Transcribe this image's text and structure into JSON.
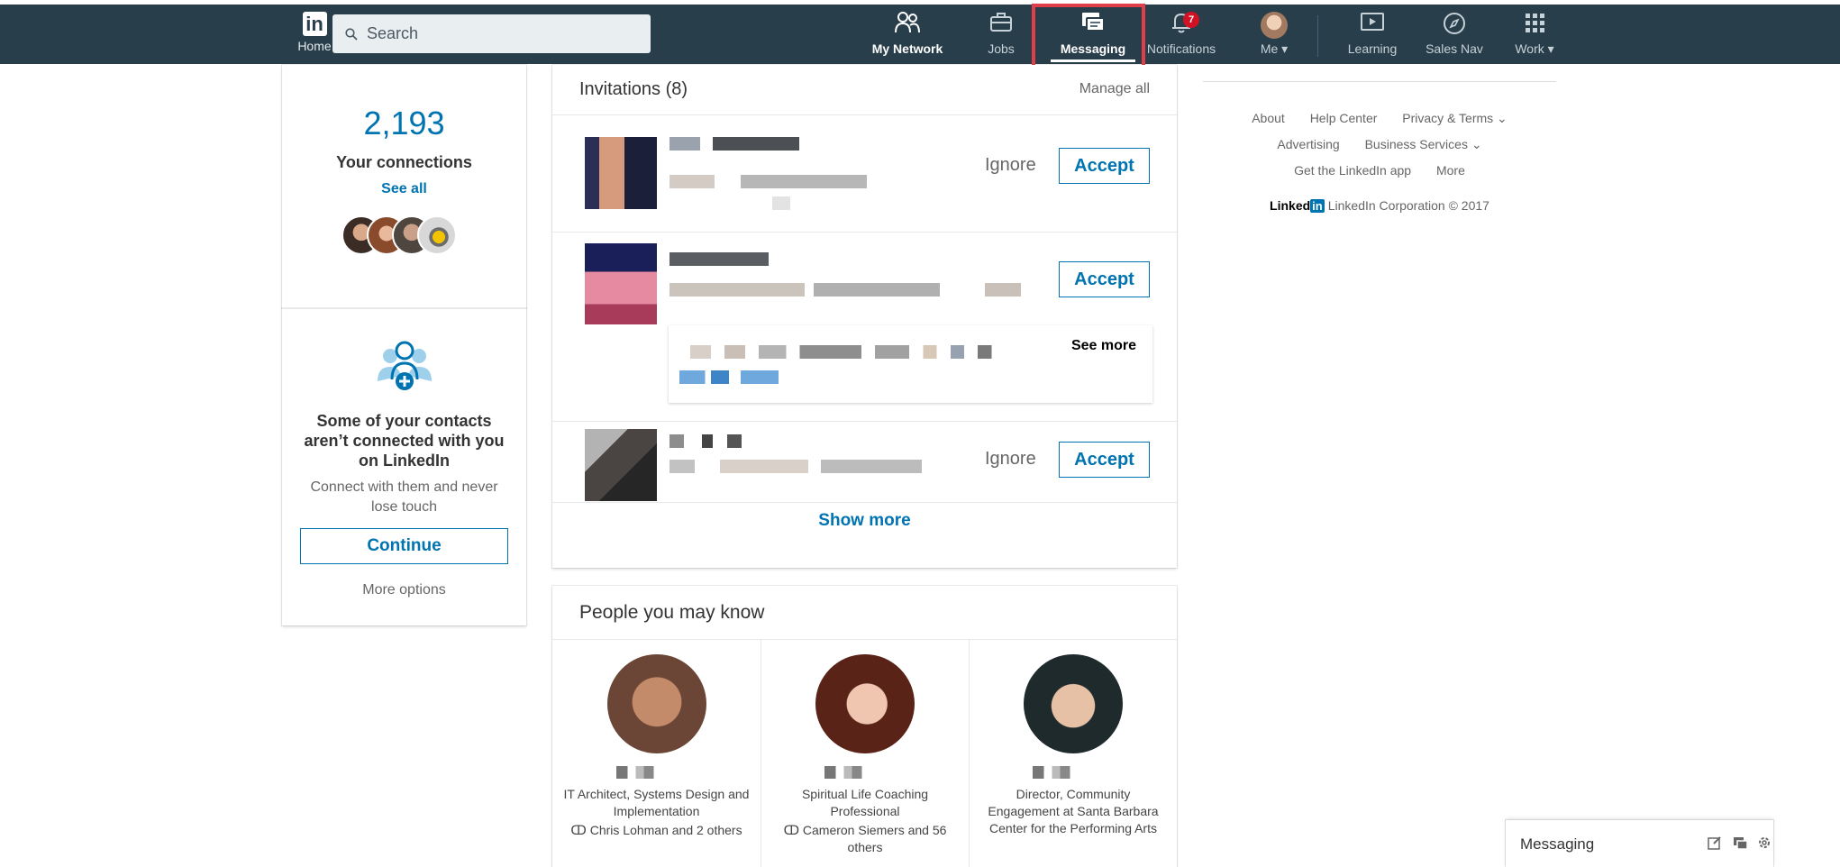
{
  "nav": {
    "home_label": "Home",
    "logo_text": "in",
    "search_placeholder": "Search",
    "items": [
      {
        "label": "My Network"
      },
      {
        "label": "Jobs"
      },
      {
        "label": "Messaging"
      },
      {
        "label": "Notifications"
      },
      {
        "label": "Me ▾"
      },
      {
        "label": "Learning"
      },
      {
        "label": "Sales Nav"
      },
      {
        "label": "Work ▾"
      }
    ],
    "notifications_count": "7",
    "colors": {
      "bar": "#283e4a",
      "highlight": "#e03e48",
      "accent": "#0073b1"
    }
  },
  "connections": {
    "count": "2,193",
    "label": "Your connections",
    "see_all": "See all"
  },
  "contacts": {
    "title": "Some of your contacts aren’t connected with you on LinkedIn",
    "subtitle": "Connect with them and never lose touch",
    "continue_label": "Continue",
    "more_options": "More options"
  },
  "invitations": {
    "title": "Invitations (8)",
    "manage_all": "Manage all",
    "ignore_label": "Ignore",
    "accept_label": "Accept",
    "see_more": "See more",
    "show_more": "Show more"
  },
  "pymk": {
    "title": "People you may know",
    "people": [
      {
        "occupation": "IT Architect, Systems Design and Implementation",
        "shared": "Chris Lohman and 2 others"
      },
      {
        "occupation": "Spiritual Life Coaching Professional",
        "shared": "Cameron Siemers and 56 others"
      },
      {
        "occupation": "Director, Community Engagement at Santa Barbara Center for the Performing Arts",
        "shared": ""
      }
    ]
  },
  "footer": {
    "links_row1": [
      "About",
      "Help Center",
      "Privacy & Terms ⌄"
    ],
    "links_row2": [
      "Advertising",
      "Business Services ⌄"
    ],
    "links_row3": [
      "Get the LinkedIn app",
      "More"
    ],
    "brand": "Linked",
    "brand_in": "in",
    "copyright": "LinkedIn Corporation © 2017"
  },
  "messaging_dock": {
    "label": "Messaging"
  }
}
